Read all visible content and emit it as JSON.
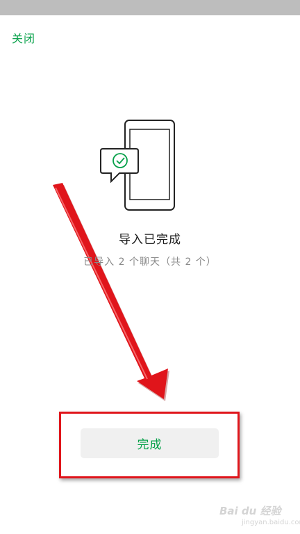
{
  "header": {
    "close_label": "关闭"
  },
  "result": {
    "title": "导入已完成",
    "subtitle": "已导入 2 个聊天（共 2 个）"
  },
  "actions": {
    "done_label": "完成"
  },
  "watermark": {
    "brand": "Bai du 经验",
    "url": "jingyan.baidu.com"
  },
  "colors": {
    "accent": "#07a14a",
    "annotation_red": "#e0151b",
    "status_bar": "#bdbdbd"
  },
  "icons": {
    "illustration": "phone-with-check-bubble-icon",
    "annotation": "red-arrow-annotation"
  }
}
